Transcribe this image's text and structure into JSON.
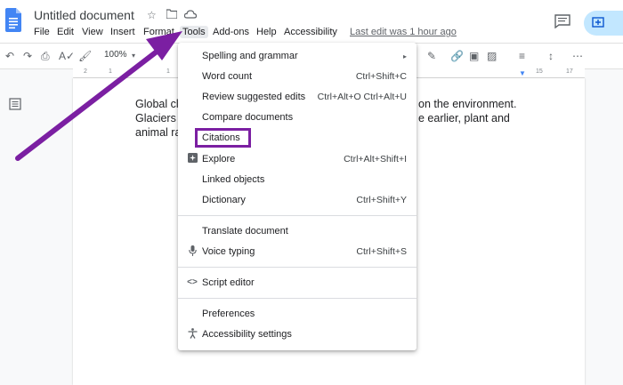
{
  "document": {
    "title": "Untitled document"
  },
  "menubar": {
    "items": [
      "File",
      "Edit",
      "View",
      "Insert",
      "Format",
      "Tools",
      "Add-ons",
      "Help",
      "Accessibility"
    ],
    "last_edit": "Last edit was 1 hour ago"
  },
  "toolbar": {
    "zoom": "100%"
  },
  "ruler": {
    "numbers": [
      "2",
      "1",
      "1",
      "2",
      "3",
      "4",
      "5",
      "6",
      "7",
      "8",
      "9",
      "10",
      "11",
      "12",
      "13",
      "14",
      "15",
      "16",
      "17",
      "18"
    ]
  },
  "body": {
    "line1_start": "Global cl",
    "line1_end": "on the environment.",
    "line2_start": "Glaciers",
    "line2_end": "e earlier, plant and",
    "line3_start": "animal ra"
  },
  "tools_menu": {
    "items": [
      {
        "label": "Spelling and grammar",
        "shortcut": "▸"
      },
      {
        "label": "Word count",
        "shortcut": "Ctrl+Shift+C"
      },
      {
        "label": "Review suggested edits",
        "shortcut": "Ctrl+Alt+O Ctrl+Alt+U"
      },
      {
        "label": "Compare documents",
        "shortcut": ""
      },
      {
        "label": "Citations",
        "shortcut": ""
      },
      {
        "label": "Explore",
        "shortcut": "Ctrl+Alt+Shift+I"
      },
      {
        "label": "Linked objects",
        "shortcut": ""
      },
      {
        "label": "Dictionary",
        "shortcut": "Ctrl+Shift+Y"
      },
      {
        "label": "Translate document",
        "shortcut": ""
      },
      {
        "label": "Voice typing",
        "shortcut": "Ctrl+Shift+S"
      },
      {
        "label": "Script editor",
        "shortcut": ""
      },
      {
        "label": "Preferences",
        "shortcut": ""
      },
      {
        "label": "Accessibility settings",
        "shortcut": ""
      }
    ]
  },
  "colors": {
    "accent": "#7b1fa2",
    "doc_blue": "#4285f4",
    "share_bg": "#c2e7ff"
  }
}
